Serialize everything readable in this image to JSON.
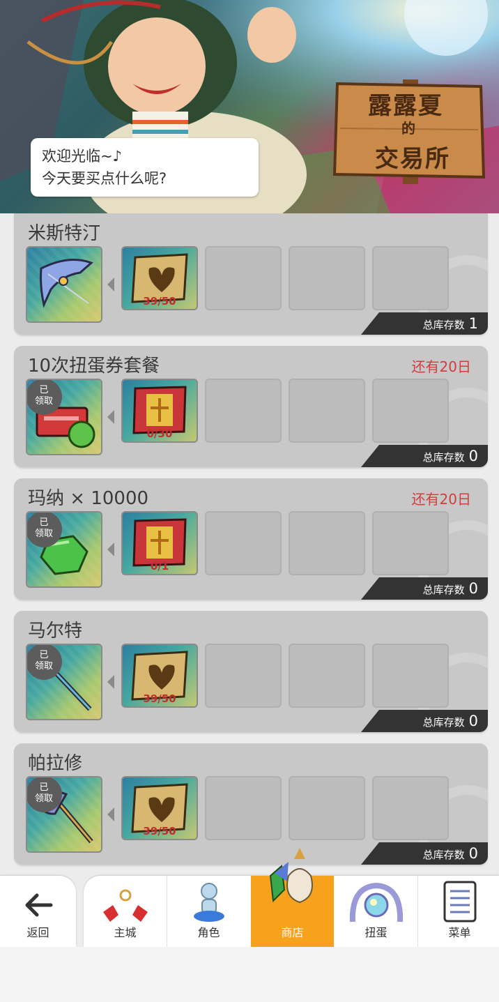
{
  "banner": {
    "greeting_line1": "欢迎光临~♪",
    "greeting_line2": "今天要买点什么呢?",
    "sign_line1": "露露夏",
    "sign_line2": "的",
    "sign_line3": "交易所"
  },
  "stock_label": "总库存数",
  "claimed_label_1": "已",
  "claimed_label_2": "领取",
  "items": [
    {
      "title": "米斯特汀",
      "timer": "",
      "claimed": false,
      "reward_icon": "bow-icon",
      "cost_icon": "ticket-scroll-icon",
      "cost_count": "39/50",
      "stock": "1"
    },
    {
      "title": "10次扭蛋券套餐",
      "timer": "还有20日",
      "claimed": true,
      "reward_icon": "gacha-ticket-icon",
      "cost_icon": "event-scroll-icon",
      "cost_count": "0/30",
      "stock": "0"
    },
    {
      "title": "玛纳 × 10000",
      "timer": "还有20日",
      "claimed": true,
      "reward_icon": "mana-gem-icon",
      "cost_icon": "event-scroll-icon",
      "cost_count": "0/1",
      "stock": "0"
    },
    {
      "title": "马尔特",
      "timer": "",
      "claimed": true,
      "reward_icon": "spear-icon",
      "cost_icon": "ticket-scroll-icon",
      "cost_count": "39/50",
      "stock": "0"
    },
    {
      "title": "帕拉修",
      "timer": "",
      "claimed": true,
      "reward_icon": "axe-icon",
      "cost_icon": "ticket-scroll-icon",
      "cost_count": "39/50",
      "stock": "0"
    }
  ],
  "nav": {
    "back": "返回",
    "town": "主城",
    "character": "角色",
    "shop": "商店",
    "gacha": "扭蛋",
    "menu": "菜单",
    "active": "shop"
  },
  "colors": {
    "accent": "#f7a21d",
    "timer": "#d43c3c",
    "cost_count": "#c0302a"
  }
}
